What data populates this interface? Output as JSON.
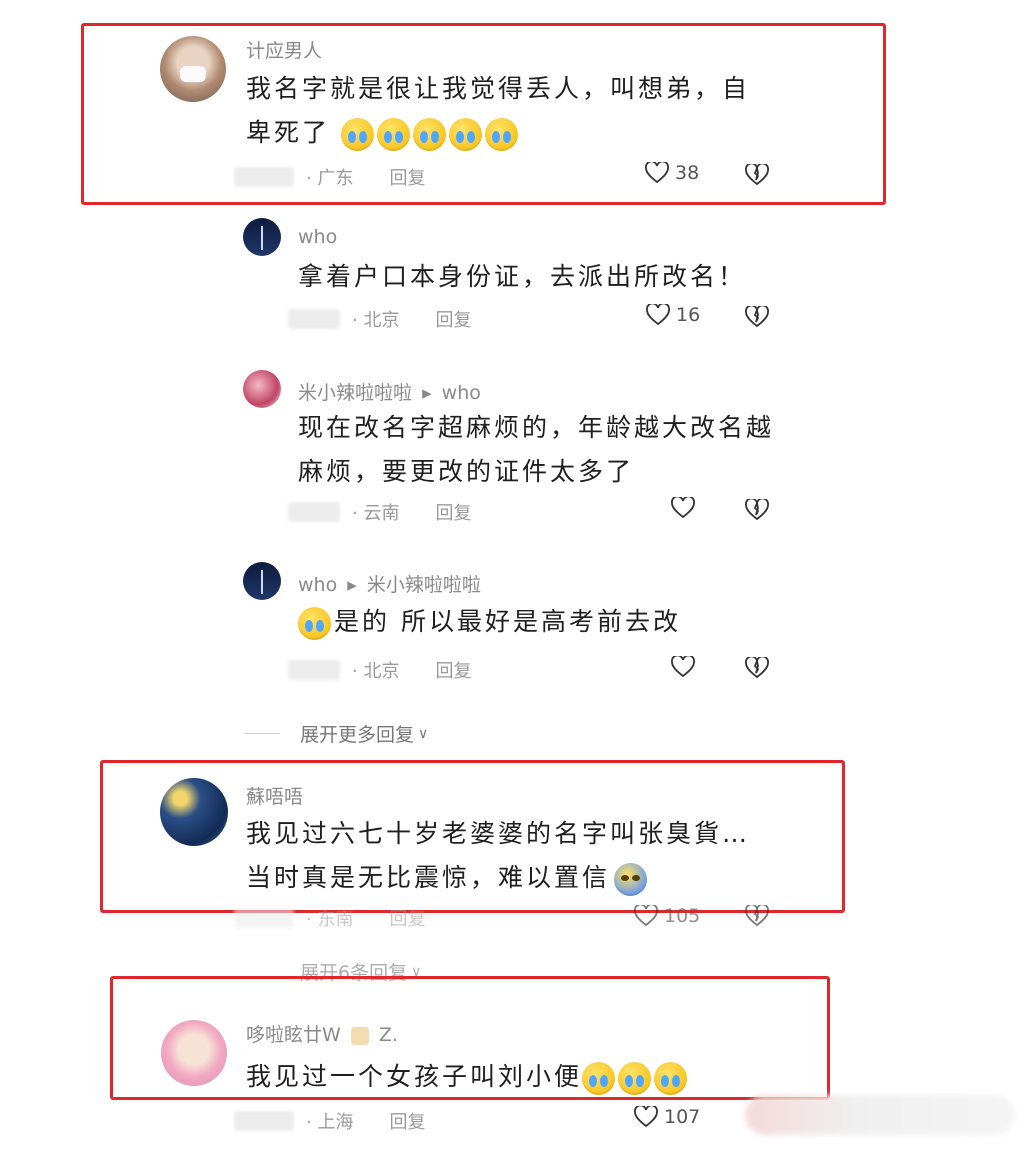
{
  "comments": [
    {
      "name": "计应男人",
      "text_line1": "我名字就是很让我觉得丢人，叫想弟，自",
      "text_line2": "卑死了",
      "location": "· 广东",
      "reply": "回复",
      "likes": "38"
    },
    {
      "name": "who",
      "text": "拿着户口本身份证，去派出所改名！",
      "location": "· 北京",
      "reply": "回复",
      "likes": "16"
    },
    {
      "name": "米小辣啦啦啦",
      "reply_to_arrow": "▸",
      "reply_to": "who",
      "text_line1": "现在改名字超麻烦的，年龄越大改名越",
      "text_line2": "麻烦，要更改的证件太多了",
      "location": "· 云南",
      "reply": "回复"
    },
    {
      "name": "who",
      "reply_to_arrow": "▸",
      "reply_to": "米小辣啦啦啦",
      "text": "是的 所以最好是高考前去改",
      "location": "· 北京",
      "reply": "回复"
    },
    {
      "name": "蘇唔唔",
      "text_line1": "我见过六七十岁老婆婆的名字叫张臭貨…",
      "text_line2": "当时真是无比震惊，难以置信",
      "location": "· 东南",
      "reply": "回复",
      "likes": "105"
    },
    {
      "name": "哆啦眩廿W",
      "name_suffix": "Z.",
      "text": "我见过一个女孩子叫刘小便",
      "location": "· 上海",
      "reply": "回复",
      "likes": "107"
    }
  ],
  "expand_more": "展开更多回复",
  "expand_six": "展开6条回复",
  "colors": {
    "highlight_box": "#e0282c"
  }
}
